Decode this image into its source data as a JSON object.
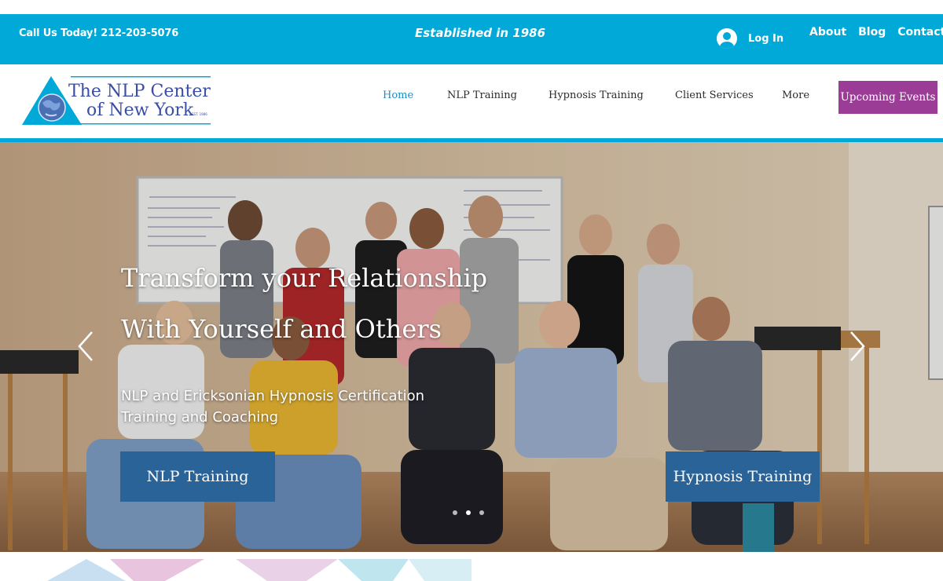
{
  "topbar": {
    "phone": "Call Us Today! 212-203-5076",
    "established": "Established in 1986",
    "login_label": "Log In",
    "links": [
      "About",
      "Blog",
      "Contact"
    ]
  },
  "logo": {
    "line1": "The NLP Center",
    "line2": "of New York",
    "est": "EST. 1986"
  },
  "nav": {
    "items": [
      "Home",
      "NLP Training",
      "Hypnosis Training",
      "Client Services",
      "More"
    ],
    "active": "Home",
    "cta": "Upcoming Events"
  },
  "hero": {
    "title_line1": "Transform your Relationship",
    "title_line2": "With Yourself and Others",
    "subtitle": "NLP and Ericksonian Hypnosis Certification Training and Coaching",
    "btn_nlp": "NLP Training",
    "btn_hypnosis": "Hypnosis Training",
    "slides": 3,
    "active_slide": 2
  },
  "colors": {
    "accent": "#00a9d8",
    "cta": "#9b3c97",
    "hero_button": "#2a6398",
    "active_nav": "#1a8fc4"
  }
}
